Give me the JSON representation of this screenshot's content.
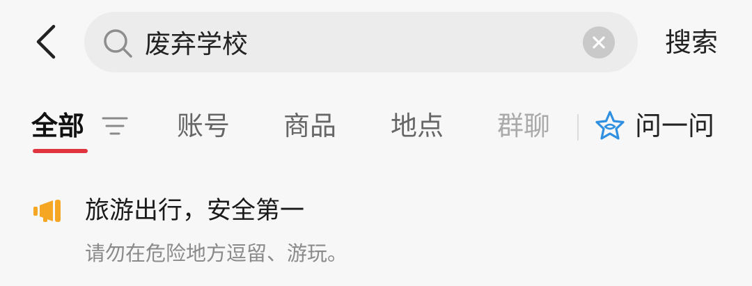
{
  "header": {
    "back_icon": "chevron-left-icon",
    "search": {
      "value": "废弃学校",
      "icon": "search-icon",
      "clear_icon": "clear-icon"
    },
    "search_button_label": "搜索"
  },
  "tabs": [
    {
      "label": "全部",
      "active": true
    },
    {
      "label": "账号",
      "active": false
    },
    {
      "label": "商品",
      "active": false
    },
    {
      "label": "地点",
      "active": false
    },
    {
      "label": "群聊",
      "active": false
    }
  ],
  "filter_icon": "filter-icon",
  "ask": {
    "label": "问一问",
    "icon": "sparkle-star-icon"
  },
  "notice": {
    "icon": "megaphone-icon",
    "title": "旅游出行，安全第一",
    "subtitle": "请勿在危险地方逗留、游玩。"
  },
  "colors": {
    "active_tab_underline": "#e0343f",
    "notice_icon": "#f5a623",
    "ask_icon": "#2f8fe0",
    "search_box_bg": "#ececec",
    "page_bg": "#f7f7f7"
  }
}
